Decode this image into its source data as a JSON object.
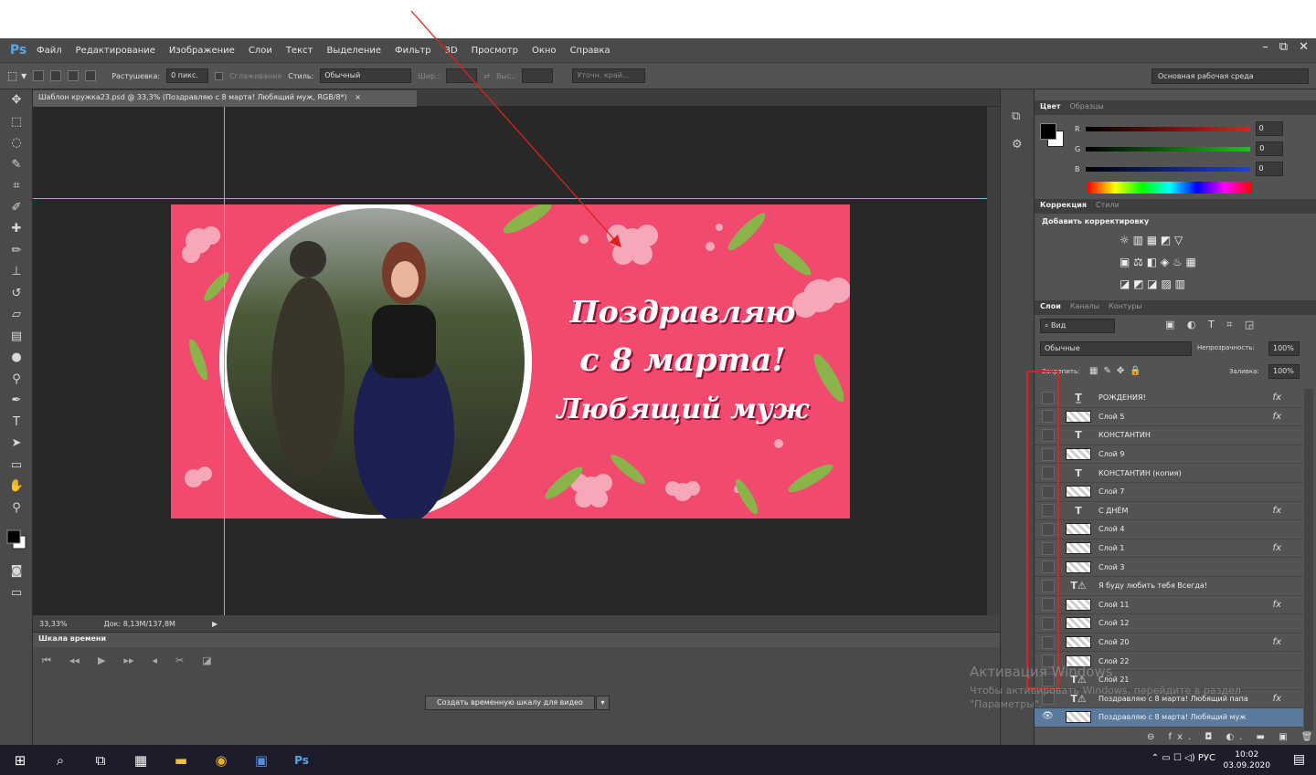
{
  "app": {
    "logo": "Ps",
    "window_buttons": [
      "–",
      "⧉",
      "✕"
    ]
  },
  "menu": [
    "Файл",
    "Редактирование",
    "Изображение",
    "Слои",
    "Текст",
    "Выделение",
    "Фильтр",
    "3D",
    "Просмотр",
    "Окно",
    "Справка"
  ],
  "options": {
    "feather_label": "Растушевка:",
    "feather_value": "0 пикс.",
    "antialias_label": "Сглаживание",
    "style_label": "Стиль:",
    "style_value": "Обычный",
    "width_label": "Шир.:",
    "height_label": "Выс.:",
    "refine_edge": "Уточн. край...",
    "workspace": "Основная рабочая среда"
  },
  "document": {
    "tab_title": "Шаблон кружка23.psd @ 33,3% (Поздравляю с 8 марта! Любящий муж, RGB/8*)",
    "close": "×"
  },
  "artwork": {
    "line1": "Поздравляю",
    "line2": "с 8 марта!",
    "line3": "Любящий муж"
  },
  "status": {
    "zoom": "33,33%",
    "doc": "Док: 8,13M/137,8M"
  },
  "timeline": {
    "title": "Шкала времени",
    "create_button": "Создать временную шкалу для видео"
  },
  "color_panel": {
    "tabs": [
      "Цвет",
      "Образцы"
    ],
    "channels": [
      {
        "label": "R",
        "value": "0",
        "color": "#e02020"
      },
      {
        "label": "G",
        "value": "0",
        "color": "#20c020"
      },
      {
        "label": "B",
        "value": "0",
        "color": "#2040e0"
      }
    ]
  },
  "adjustments": {
    "tabs": [
      "Коррекция",
      "Стили"
    ],
    "title": "Добавить корректировку",
    "icons_row1": "☼ ▥ ▦ ◩ ▽",
    "icons_row2": "▣ ⚖ ◧ ◈ ♨ ▦",
    "icons_row3": "◪ ◩ ◪ ▨ ▥"
  },
  "layers_panel": {
    "tabs": [
      "Слои",
      "Каналы",
      "Контуры"
    ],
    "kind": "Вид",
    "blend": "Обычные",
    "opacity_label": "Непрозрачность:",
    "opacity": "100%",
    "lock_label": "Закрепить:",
    "fill_label": "Заливка:",
    "fill": "100%",
    "items": [
      {
        "type": "text",
        "icon": "T̲",
        "name": "РОЖДЕНИЯ!",
        "fx": "fx"
      },
      {
        "type": "image",
        "name": "Слой 5",
        "fx": "fx"
      },
      {
        "type": "text",
        "icon": "T",
        "name": "КОНСТАНТИН",
        "fx": ""
      },
      {
        "type": "image",
        "name": "Слой 9",
        "fx": ""
      },
      {
        "type": "text",
        "icon": "T",
        "name": "КОНСТАНТИН (копия)",
        "fx": ""
      },
      {
        "type": "image",
        "name": "Слой 7",
        "fx": ""
      },
      {
        "type": "text",
        "icon": "T",
        "name": "С ДНЁМ",
        "fx": "fx"
      },
      {
        "type": "image",
        "name": "Слой 4",
        "fx": ""
      },
      {
        "type": "image",
        "name": "Слой 1",
        "fx": "fx"
      },
      {
        "type": "image",
        "name": "Слой 3",
        "fx": ""
      },
      {
        "type": "text",
        "icon": "T⚠",
        "name": "Я буду любить тебя Всегда!",
        "fx": ""
      },
      {
        "type": "image",
        "name": "Слой 11",
        "fx": "fx"
      },
      {
        "type": "image",
        "name": "Слой 12",
        "fx": ""
      },
      {
        "type": "image",
        "name": "Слой 20",
        "fx": "fx"
      },
      {
        "type": "image",
        "name": "Слой 22",
        "fx": ""
      },
      {
        "type": "text",
        "icon": "T⚠",
        "name": "Слой 21",
        "fx": ""
      },
      {
        "type": "text",
        "icon": "T⚠",
        "name": "Поздравляю с 8 марта! Любящий папа",
        "fx": "fx"
      },
      {
        "type": "image",
        "name": "Поздравляю с 8 марта! Любящий муж",
        "fx": "",
        "visible": "👁",
        "selected": true
      }
    ],
    "bottom_icons": "⊖ fx. ◘ ◐. ▬ ▣ 🗑"
  },
  "watermark": {
    "line1": "Активация Windows",
    "line2": "Чтобы активировать Windows, перейдите в раздел",
    "line3": "\"Параметры\"."
  },
  "taskbar": {
    "icons": [
      "⊞",
      "⌕",
      "⧉",
      "▦",
      "▬",
      "◉",
      "▣",
      "Ps"
    ],
    "tray": "⌃ ▭ ☐ ◁) РУС",
    "time": "10:02",
    "date": "03.09.2020",
    "notif": "▤"
  },
  "colors": {
    "accent_red": "#e02020",
    "artwork_bg": "#f2496f",
    "guide": "#4fd1d9",
    "ps_blue": "#58a6e8"
  }
}
